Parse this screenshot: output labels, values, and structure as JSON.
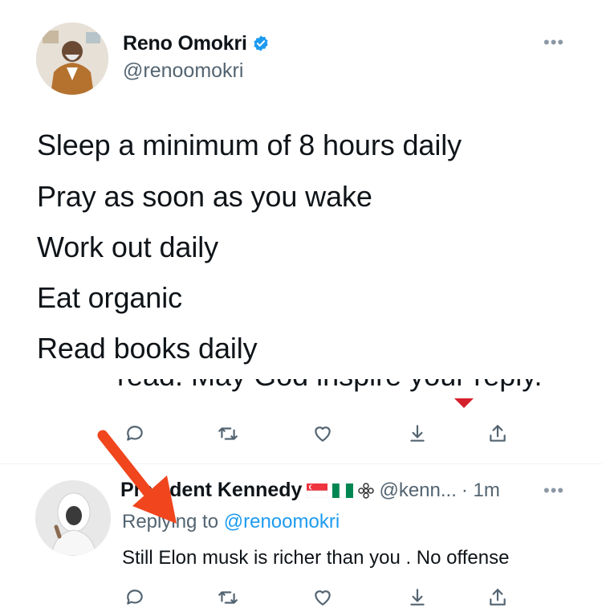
{
  "tweet": {
    "author_name": "Reno Omokri",
    "author_handle": "@renoomokri",
    "lines": [
      "Sleep a minimum of 8 hours daily",
      "Pray as soon as you wake",
      "Work out daily",
      "Eat organic",
      "Read books daily"
    ],
    "partial_line": "read. May God inspire your reply."
  },
  "reply": {
    "author_name": "President Kennedy",
    "author_handle": "@kenn...",
    "time": "· 1m",
    "replying_label": "Replying to",
    "replying_handle": "@renoomokri",
    "text": "Still Elon musk is richer than you . No offense"
  },
  "colors": {
    "text": "#0f1419",
    "secondary": "#536471",
    "link": "#1d9bf0",
    "verified": "#1d9bf0",
    "annotation_arrow": "#f0451d"
  },
  "icons": [
    "reply-icon",
    "retweet-icon",
    "like-icon",
    "download-icon",
    "share-icon",
    "verified-icon",
    "more-icon"
  ]
}
